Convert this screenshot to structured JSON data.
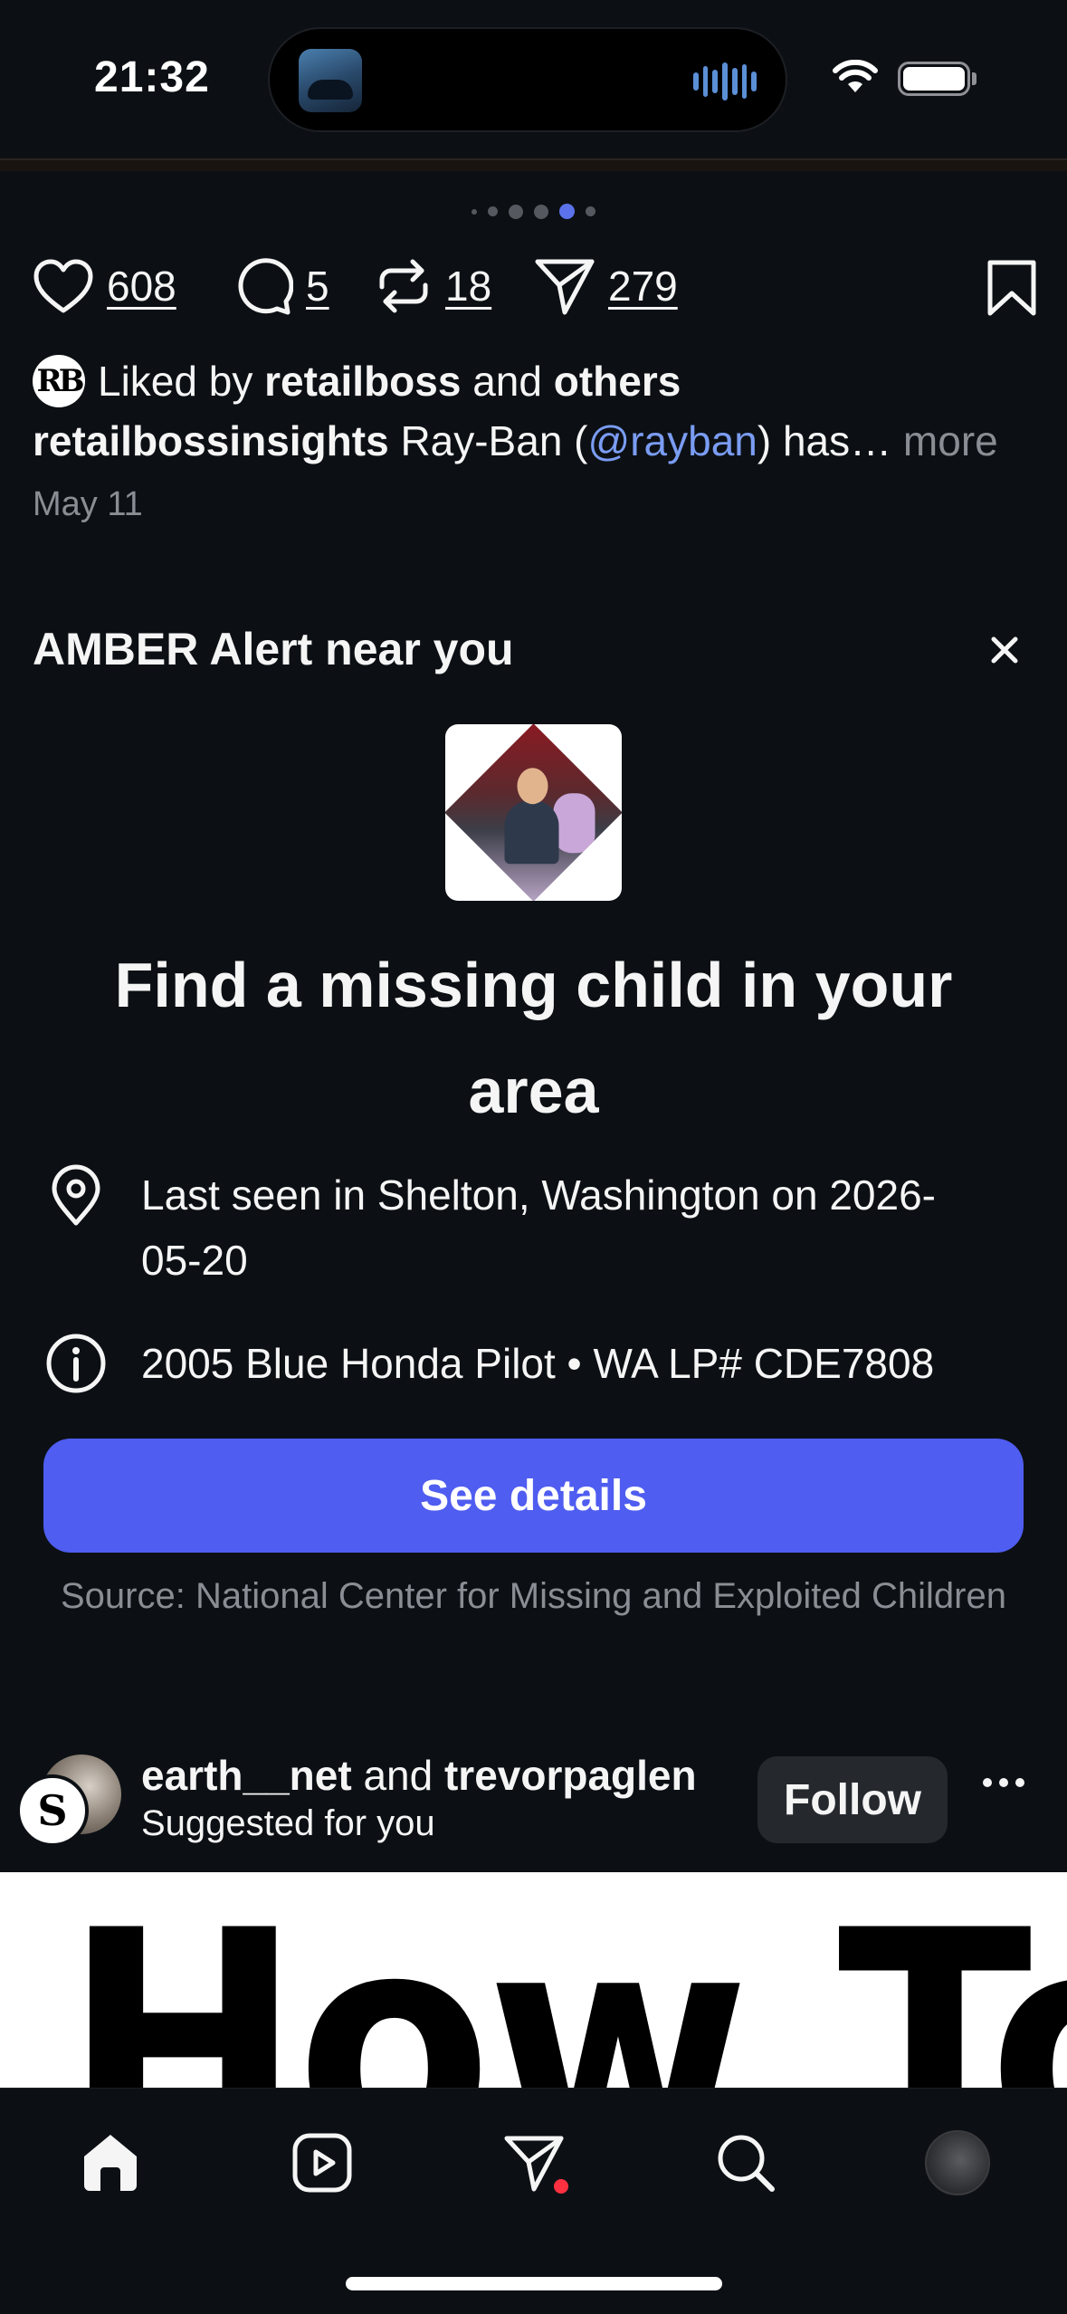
{
  "status_bar": {
    "time": "21:32"
  },
  "post": {
    "likes": "608",
    "comments": "5",
    "reposts": "18",
    "shares": "279",
    "liked_by": {
      "avatar_initials": "RB",
      "prefix": "Liked by",
      "user": "retailboss",
      "joiner": "and",
      "others": "others"
    },
    "caption": {
      "username": "retailbossinsights",
      "text_before": "Ray-Ban (",
      "mention": "@rayban",
      "text_after": ") has…",
      "more": "more"
    },
    "date": "May 11"
  },
  "amber_alert": {
    "title": "AMBER Alert near you",
    "headline": "Find a missing child in your area",
    "last_seen": "Last seen in Shelton, Washington on 2026-05-20",
    "vehicle": "2005 Blue Honda Pilot • WA LP# CDE7808",
    "button": "See details",
    "source": "Source: National Center for Missing and Exploited Children"
  },
  "suggested": {
    "user1": "earth__net",
    "joiner": "and",
    "user2": "trevorpaglen",
    "subtitle": "Suggested for you",
    "follow": "Follow",
    "front_avatar_letter": "S"
  },
  "next_post": {
    "image_text": "How To See"
  },
  "tabbar": {
    "tabs": [
      "home-icon",
      "reels-icon",
      "messages-icon",
      "search-icon",
      "profile-avatar"
    ]
  },
  "colors": {
    "background": "#0c1014",
    "accent": "#4f5df0",
    "mention": "#7a9cf3",
    "notification": "#ff3040"
  }
}
